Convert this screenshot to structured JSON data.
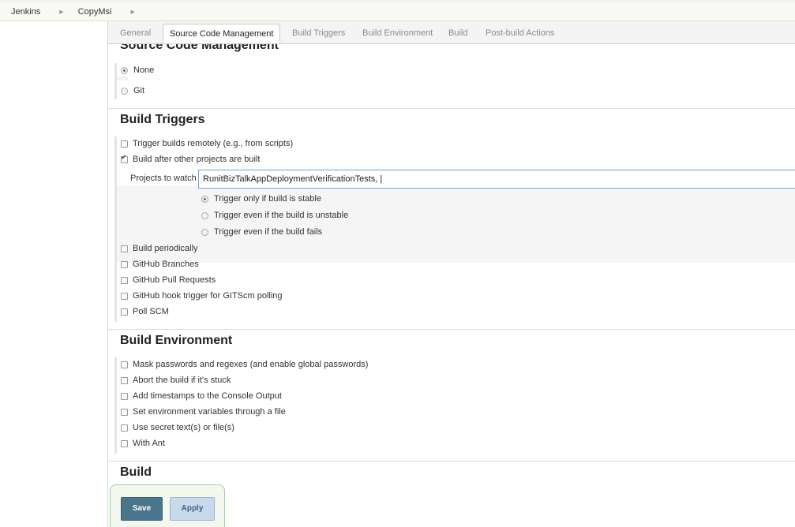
{
  "breadcrumb": {
    "items": [
      "Jenkins",
      "CopyMsi"
    ]
  },
  "tabs": [
    {
      "label": "General",
      "active": false
    },
    {
      "label": "Source Code Management",
      "active": true
    },
    {
      "label": "Build Triggers",
      "active": false
    },
    {
      "label": "Build Environment",
      "active": false
    },
    {
      "label": "Build",
      "active": false
    },
    {
      "label": "Post-build Actions",
      "active": false
    }
  ],
  "scm": {
    "title": "Source Code Management",
    "options": [
      {
        "label": "None",
        "checked": true
      },
      {
        "label": "Git",
        "checked": false
      }
    ]
  },
  "triggers": {
    "title": "Build Triggers",
    "remote": {
      "label": "Trigger builds remotely (e.g., from scripts)",
      "checked": false
    },
    "after_other": {
      "label": "Build after other projects are built",
      "checked": true
    },
    "projects_label": "Projects to watch",
    "projects_value": "RunitBizTalkAppDeploymentVerificationTests, |",
    "stability": [
      {
        "label": "Trigger only if build is stable",
        "checked": true
      },
      {
        "label": "Trigger even if the build is unstable",
        "checked": false
      },
      {
        "label": "Trigger even if the build fails",
        "checked": false
      }
    ],
    "more": [
      {
        "label": "Build periodically",
        "checked": false
      },
      {
        "label": "GitHub Branches",
        "checked": false
      },
      {
        "label": "GitHub Pull Requests",
        "checked": false
      },
      {
        "label": "GitHub hook trigger for GITScm polling",
        "checked": false
      },
      {
        "label": "Poll SCM",
        "checked": false
      }
    ]
  },
  "environment": {
    "title": "Build Environment",
    "options": [
      {
        "label": "Mask passwords and regexes (and enable global passwords)",
        "checked": false
      },
      {
        "label": "Abort the build if it's stuck",
        "checked": false
      },
      {
        "label": "Add timestamps to the Console Output",
        "checked": false
      },
      {
        "label": "Set environment variables through a file",
        "checked": false
      },
      {
        "label": "Use secret text(s) or file(s)",
        "checked": false
      },
      {
        "label": "With Ant",
        "checked": false
      }
    ]
  },
  "build": {
    "title": "Build"
  },
  "actions": {
    "save_label": "Save",
    "apply_label": "Apply"
  }
}
